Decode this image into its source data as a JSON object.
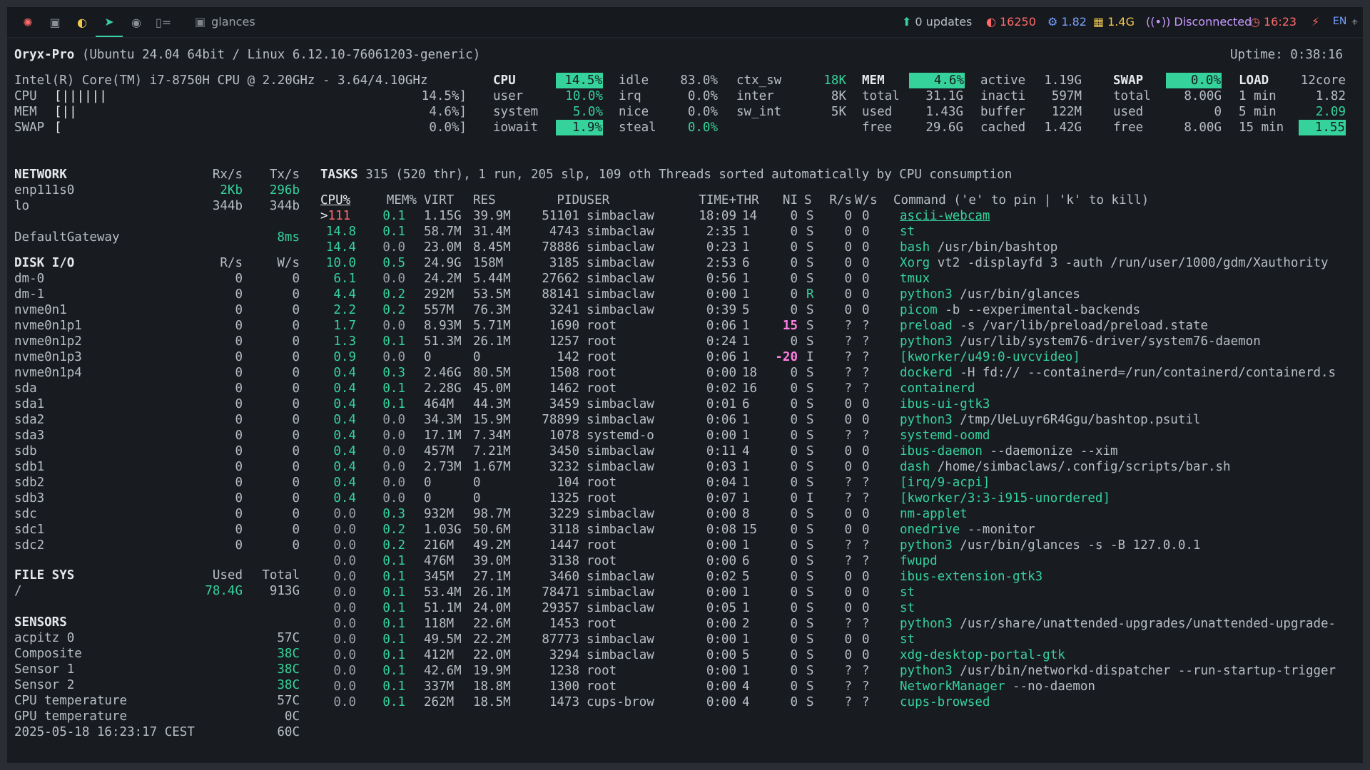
{
  "topbar": {
    "workspaces": [
      {
        "icon": "ubuntu-icon",
        "glyph": "✺"
      },
      {
        "icon": "terminal-icon",
        "glyph": "▣"
      },
      {
        "icon": "firefox-icon",
        "glyph": "◐"
      },
      {
        "icon": "telegram-icon",
        "glyph": "➤"
      },
      {
        "icon": "github-icon",
        "glyph": "◉"
      },
      {
        "icon": "code-icon",
        "glyph": "▯="
      }
    ],
    "window_title": "glances",
    "updates": "0 updates",
    "cpu_temp_freq": "16250",
    "cpu_load": "1.82",
    "memory": "1.4G",
    "network": "Disconnected",
    "clock": "16:23",
    "lang": "EN",
    "colors": {
      "accent": "#36d29c",
      "warn": "#ff6b6b",
      "info": "#7aa2ff",
      "mem": "#f2c94c",
      "net": "#c79bff"
    }
  },
  "header": {
    "host": "Oryx-Pro",
    "os": "(Ubuntu 24.04 64bit / Linux 6.12.10-76061203-generic)",
    "uptime": "Uptime: 0:38:16"
  },
  "quicklook": {
    "cpu_name": "Intel(R) Core(TM) i7-8750H CPU @ 2.20GHz - 3.64/4.10GHz",
    "cpu_bar": "[||||||",
    "cpu_pct": "14.5%]",
    "mem_bar": "[||",
    "mem_pct": "4.6%]",
    "swap_bar": "[",
    "swap_pct": "0.0%]"
  },
  "cpu": {
    "title": "CPU",
    "total": "14.5%",
    "user_l": "user",
    "user": "10.0%",
    "system_l": "system",
    "system": "5.0%",
    "iowait_l": "iowait",
    "iowait": "1.9%",
    "idle_l": "idle",
    "idle": "83.0%",
    "irq_l": "irq",
    "irq": "0.0%",
    "nice_l": "nice",
    "nice": "0.0%",
    "steal_l": "steal",
    "steal": "0.0%",
    "ctx_sw_l": "ctx_sw",
    "ctx_sw": "18K",
    "inter_l": "inter",
    "inter": "8K",
    "sw_int_l": "sw_int",
    "sw_int": "5K"
  },
  "mem": {
    "title": "MEM",
    "pct": "4.6%",
    "total_l": "total",
    "total": "31.1G",
    "used_l": "used",
    "used": "1.43G",
    "free_l": "free",
    "free": "29.6G",
    "active_l": "active",
    "active": "1.19G",
    "inacti_l": "inacti",
    "inacti": "597M",
    "buffer_l": "buffer",
    "buffer": "122M",
    "cached_l": "cached",
    "cached": "1.42G"
  },
  "swap": {
    "title": "SWAP",
    "pct": "0.0%",
    "total_l": "total",
    "total": "8.00G",
    "used_l": "used",
    "used": "0",
    "free_l": "free",
    "free": "8.00G"
  },
  "load": {
    "title": "LOAD",
    "cores": "12core",
    "m1_l": "1 min",
    "m1": "1.82",
    "m5_l": "5 min",
    "m5": "2.09",
    "m15_l": "15 min",
    "m15": "1.55"
  },
  "network": {
    "title": "NETWORK",
    "rx_h": "Rx/s",
    "tx_h": "Tx/s",
    "rows": [
      {
        "name": "enp111s0",
        "rx": "2Kb",
        "tx": "296b"
      },
      {
        "name": "lo",
        "rx": "344b",
        "tx": "344b"
      }
    ],
    "gateway": "DefaultGateway",
    "gateway_val": "8ms"
  },
  "diskio": {
    "title": "DISK I/O",
    "r_h": "R/s",
    "w_h": "W/s",
    "rows": [
      {
        "name": "dm-0",
        "r": "0",
        "w": "0"
      },
      {
        "name": "dm-1",
        "r": "0",
        "w": "0"
      },
      {
        "name": "nvme0n1",
        "r": "0",
        "w": "0"
      },
      {
        "name": "nvme0n1p1",
        "r": "0",
        "w": "0"
      },
      {
        "name": "nvme0n1p2",
        "r": "0",
        "w": "0"
      },
      {
        "name": "nvme0n1p3",
        "r": "0",
        "w": "0"
      },
      {
        "name": "nvme0n1p4",
        "r": "0",
        "w": "0"
      },
      {
        "name": "sda",
        "r": "0",
        "w": "0"
      },
      {
        "name": "sda1",
        "r": "0",
        "w": "0"
      },
      {
        "name": "sda2",
        "r": "0",
        "w": "0"
      },
      {
        "name": "sda3",
        "r": "0",
        "w": "0"
      },
      {
        "name": "sdb",
        "r": "0",
        "w": "0"
      },
      {
        "name": "sdb1",
        "r": "0",
        "w": "0"
      },
      {
        "name": "sdb2",
        "r": "0",
        "w": "0"
      },
      {
        "name": "sdb3",
        "r": "0",
        "w": "0"
      },
      {
        "name": "sdc",
        "r": "0",
        "w": "0"
      },
      {
        "name": "sdc1",
        "r": "0",
        "w": "0"
      },
      {
        "name": "sdc2",
        "r": "0",
        "w": "0"
      }
    ]
  },
  "fs": {
    "title": "FILE SYS",
    "used_h": "Used",
    "total_h": "Total",
    "rows": [
      {
        "mnt": "/",
        "used": "78.4G",
        "total": "913G"
      }
    ]
  },
  "sensors": {
    "title": "SENSORS",
    "rows": [
      {
        "name": "acpitz 0",
        "val": "57C",
        "green": false
      },
      {
        "name": "Composite",
        "val": "38C",
        "green": true
      },
      {
        "name": "Sensor 1",
        "val": "38C",
        "green": true
      },
      {
        "name": "Sensor 2",
        "val": "38C",
        "green": true
      },
      {
        "name": "CPU temperature",
        "val": "57C",
        "green": false
      },
      {
        "name": "GPU temperature",
        "val": "0C",
        "green": false
      }
    ],
    "datetime": "2025-05-18 16:23:17 CEST",
    "last_val": "60C"
  },
  "tasks": {
    "title": "TASKS",
    "summary": "315 (520 thr), 1 run, 205 slp, 109 oth Threads sorted automatically by CPU consumption",
    "headers": {
      "cpu": "CPU%",
      "mem": "MEM%",
      "virt": "VIRT",
      "res": "RES",
      "pid": "PID",
      "user": "USER",
      "time": "TIME+",
      "thr": "THR",
      "ni": "NI",
      "s": "S",
      "rs": "R/s",
      "ws": "W/s",
      "cmd": "Command ('e' to pin | 'k' to kill)"
    },
    "rows": [
      {
        "cpu": ">111",
        "mem": "0.1",
        "virt": "1.15G",
        "res": "39.9M",
        "pid": "51101",
        "user": "simbaclaw",
        "time": "18:09",
        "thr": "14",
        "ni": "0",
        "s": "S",
        "rs": "0",
        "ws": "0",
        "cmd": "ascii-webcam",
        "args": ""
      },
      {
        "cpu": "14.8",
        "mem": "0.1",
        "virt": "58.7M",
        "res": "31.4M",
        "pid": "4743",
        "user": "simbaclaw",
        "time": "2:35",
        "thr": "1",
        "ni": "0",
        "s": "S",
        "rs": "0",
        "ws": "0",
        "cmd": "st",
        "args": ""
      },
      {
        "cpu": "14.4",
        "mem": "0.0",
        "virt": "23.0M",
        "res": "8.45M",
        "pid": "78886",
        "user": "simbaclaw",
        "time": "0:23",
        "thr": "1",
        "ni": "0",
        "s": "S",
        "rs": "0",
        "ws": "0",
        "cmd": "bash",
        "args": "/usr/bin/bashtop"
      },
      {
        "cpu": "10.0",
        "mem": "0.5",
        "virt": "24.9G",
        "res": "158M",
        "pid": "3185",
        "user": "simbaclaw",
        "time": "2:53",
        "thr": "6",
        "ni": "0",
        "s": "S",
        "rs": "0",
        "ws": "0",
        "cmd": "Xorg",
        "args": "vt2 -displayfd 3 -auth /run/user/1000/gdm/Xauthority"
      },
      {
        "cpu": "6.1",
        "mem": "0.0",
        "virt": "24.2M",
        "res": "5.44M",
        "pid": "27662",
        "user": "simbaclaw",
        "time": "0:56",
        "thr": "1",
        "ni": "0",
        "s": "S",
        "rs": "0",
        "ws": "0",
        "cmd": "tmux",
        "args": ""
      },
      {
        "cpu": "4.4",
        "mem": "0.2",
        "virt": "292M",
        "res": "53.5M",
        "pid": "88141",
        "user": "simbaclaw",
        "time": "0:00",
        "thr": "1",
        "ni": "0",
        "s": "R",
        "rs": "0",
        "ws": "0",
        "cmd": "python3",
        "args": "/usr/bin/glances"
      },
      {
        "cpu": "2.2",
        "mem": "0.2",
        "virt": "557M",
        "res": "76.3M",
        "pid": "3241",
        "user": "simbaclaw",
        "time": "0:39",
        "thr": "5",
        "ni": "0",
        "s": "S",
        "rs": "0",
        "ws": "0",
        "cmd": "picom",
        "args": "-b --experimental-backends"
      },
      {
        "cpu": "1.7",
        "mem": "0.0",
        "virt": "8.93M",
        "res": "5.71M",
        "pid": "1690",
        "user": "root",
        "time": "0:06",
        "thr": "1",
        "ni": "15",
        "s": "S",
        "rs": "?",
        "ws": "?",
        "cmd": "preload",
        "args": "-s /var/lib/preload/preload.state"
      },
      {
        "cpu": "1.3",
        "mem": "0.1",
        "virt": "51.3M",
        "res": "26.1M",
        "pid": "1257",
        "user": "root",
        "time": "0:24",
        "thr": "1",
        "ni": "0",
        "s": "S",
        "rs": "?",
        "ws": "?",
        "cmd": "python3",
        "args": "/usr/lib/system76-driver/system76-daemon"
      },
      {
        "cpu": "0.9",
        "mem": "0.0",
        "virt": "0",
        "res": "0",
        "pid": "142",
        "user": "root",
        "time": "0:06",
        "thr": "1",
        "ni": "-20",
        "s": "I",
        "rs": "?",
        "ws": "?",
        "cmd": "[kworker/u49:0-uvcvideo]",
        "args": ""
      },
      {
        "cpu": "0.4",
        "mem": "0.3",
        "virt": "2.46G",
        "res": "80.5M",
        "pid": "1508",
        "user": "root",
        "time": "0:00",
        "thr": "18",
        "ni": "0",
        "s": "S",
        "rs": "?",
        "ws": "?",
        "cmd": "dockerd",
        "args": "-H fd:// --containerd=/run/containerd/containerd.s"
      },
      {
        "cpu": "0.4",
        "mem": "0.1",
        "virt": "2.28G",
        "res": "45.0M",
        "pid": "1462",
        "user": "root",
        "time": "0:02",
        "thr": "16",
        "ni": "0",
        "s": "S",
        "rs": "?",
        "ws": "?",
        "cmd": "containerd",
        "args": ""
      },
      {
        "cpu": "0.4",
        "mem": "0.1",
        "virt": "464M",
        "res": "44.3M",
        "pid": "3459",
        "user": "simbaclaw",
        "time": "0:01",
        "thr": "6",
        "ni": "0",
        "s": "S",
        "rs": "0",
        "ws": "0",
        "cmd": "ibus-ui-gtk3",
        "args": ""
      },
      {
        "cpu": "0.4",
        "mem": "0.0",
        "virt": "34.3M",
        "res": "15.9M",
        "pid": "78899",
        "user": "simbaclaw",
        "time": "0:06",
        "thr": "1",
        "ni": "0",
        "s": "S",
        "rs": "0",
        "ws": "0",
        "cmd": "python3",
        "args": "/tmp/UeLuyr6R4Ggu/bashtop.psutil"
      },
      {
        "cpu": "0.4",
        "mem": "0.0",
        "virt": "17.1M",
        "res": "7.34M",
        "pid": "1078",
        "user": "systemd-o",
        "time": "0:00",
        "thr": "1",
        "ni": "0",
        "s": "S",
        "rs": "?",
        "ws": "?",
        "cmd": "systemd-oomd",
        "args": ""
      },
      {
        "cpu": "0.4",
        "mem": "0.0",
        "virt": "457M",
        "res": "7.21M",
        "pid": "3450",
        "user": "simbaclaw",
        "time": "0:11",
        "thr": "4",
        "ni": "0",
        "s": "S",
        "rs": "0",
        "ws": "0",
        "cmd": "ibus-daemon",
        "args": "--daemonize --xim"
      },
      {
        "cpu": "0.4",
        "mem": "0.0",
        "virt": "2.73M",
        "res": "1.67M",
        "pid": "3232",
        "user": "simbaclaw",
        "time": "0:03",
        "thr": "1",
        "ni": "0",
        "s": "S",
        "rs": "0",
        "ws": "0",
        "cmd": "dash",
        "args": "/home/simbaclaws/.config/scripts/bar.sh"
      },
      {
        "cpu": "0.4",
        "mem": "0.0",
        "virt": "0",
        "res": "0",
        "pid": "104",
        "user": "root",
        "time": "0:04",
        "thr": "1",
        "ni": "0",
        "s": "S",
        "rs": "?",
        "ws": "?",
        "cmd": "[irq/9-acpi]",
        "args": ""
      },
      {
        "cpu": "0.4",
        "mem": "0.0",
        "virt": "0",
        "res": "0",
        "pid": "1325",
        "user": "root",
        "time": "0:07",
        "thr": "1",
        "ni": "0",
        "s": "I",
        "rs": "?",
        "ws": "?",
        "cmd": "[kworker/3:3-i915-unordered]",
        "args": ""
      },
      {
        "cpu": "0.0",
        "mem": "0.3",
        "virt": "932M",
        "res": "98.7M",
        "pid": "3229",
        "user": "simbaclaw",
        "time": "0:00",
        "thr": "8",
        "ni": "0",
        "s": "S",
        "rs": "0",
        "ws": "0",
        "cmd": "nm-applet",
        "args": ""
      },
      {
        "cpu": "0.0",
        "mem": "0.2",
        "virt": "1.03G",
        "res": "50.6M",
        "pid": "3118",
        "user": "simbaclaw",
        "time": "0:08",
        "thr": "15",
        "ni": "0",
        "s": "S",
        "rs": "0",
        "ws": "0",
        "cmd": "onedrive",
        "args": "--monitor"
      },
      {
        "cpu": "0.0",
        "mem": "0.2",
        "virt": "216M",
        "res": "49.2M",
        "pid": "1447",
        "user": "root",
        "time": "0:00",
        "thr": "1",
        "ni": "0",
        "s": "S",
        "rs": "?",
        "ws": "?",
        "cmd": "python3",
        "args": "/usr/bin/glances -s -B 127.0.0.1"
      },
      {
        "cpu": "0.0",
        "mem": "0.1",
        "virt": "476M",
        "res": "39.0M",
        "pid": "3138",
        "user": "root",
        "time": "0:00",
        "thr": "6",
        "ni": "0",
        "s": "S",
        "rs": "?",
        "ws": "?",
        "cmd": "fwupd",
        "args": ""
      },
      {
        "cpu": "0.0",
        "mem": "0.1",
        "virt": "345M",
        "res": "27.1M",
        "pid": "3460",
        "user": "simbaclaw",
        "time": "0:02",
        "thr": "5",
        "ni": "0",
        "s": "S",
        "rs": "0",
        "ws": "0",
        "cmd": "ibus-extension-gtk3",
        "args": ""
      },
      {
        "cpu": "0.0",
        "mem": "0.1",
        "virt": "53.4M",
        "res": "26.1M",
        "pid": "78471",
        "user": "simbaclaw",
        "time": "0:00",
        "thr": "1",
        "ni": "0",
        "s": "S",
        "rs": "0",
        "ws": "0",
        "cmd": "st",
        "args": ""
      },
      {
        "cpu": "0.0",
        "mem": "0.1",
        "virt": "51.1M",
        "res": "24.0M",
        "pid": "29357",
        "user": "simbaclaw",
        "time": "0:05",
        "thr": "1",
        "ni": "0",
        "s": "S",
        "rs": "0",
        "ws": "0",
        "cmd": "st",
        "args": ""
      },
      {
        "cpu": "0.0",
        "mem": "0.1",
        "virt": "118M",
        "res": "22.6M",
        "pid": "1453",
        "user": "root",
        "time": "0:00",
        "thr": "2",
        "ni": "0",
        "s": "S",
        "rs": "?",
        "ws": "?",
        "cmd": "python3",
        "args": "/usr/share/unattended-upgrades/unattended-upgrade-"
      },
      {
        "cpu": "0.0",
        "mem": "0.1",
        "virt": "49.5M",
        "res": "22.2M",
        "pid": "87773",
        "user": "simbaclaw",
        "time": "0:00",
        "thr": "1",
        "ni": "0",
        "s": "S",
        "rs": "0",
        "ws": "0",
        "cmd": "st",
        "args": ""
      },
      {
        "cpu": "0.0",
        "mem": "0.1",
        "virt": "412M",
        "res": "22.0M",
        "pid": "3294",
        "user": "simbaclaw",
        "time": "0:00",
        "thr": "5",
        "ni": "0",
        "s": "S",
        "rs": "0",
        "ws": "0",
        "cmd": "xdg-desktop-portal-gtk",
        "args": ""
      },
      {
        "cpu": "0.0",
        "mem": "0.1",
        "virt": "42.6M",
        "res": "19.9M",
        "pid": "1238",
        "user": "root",
        "time": "0:00",
        "thr": "1",
        "ni": "0",
        "s": "S",
        "rs": "?",
        "ws": "?",
        "cmd": "python3",
        "args": "/usr/bin/networkd-dispatcher --run-startup-trigger"
      },
      {
        "cpu": "0.0",
        "mem": "0.1",
        "virt": "337M",
        "res": "18.8M",
        "pid": "1300",
        "user": "root",
        "time": "0:00",
        "thr": "4",
        "ni": "0",
        "s": "S",
        "rs": "?",
        "ws": "?",
        "cmd": "NetworkManager",
        "args": "--no-daemon"
      },
      {
        "cpu": "0.0",
        "mem": "0.1",
        "virt": "262M",
        "res": "18.5M",
        "pid": "1473",
        "user": "cups-brow",
        "time": "0:00",
        "thr": "4",
        "ni": "0",
        "s": "S",
        "rs": "?",
        "ws": "?",
        "cmd": "cups-browsed",
        "args": ""
      }
    ]
  }
}
